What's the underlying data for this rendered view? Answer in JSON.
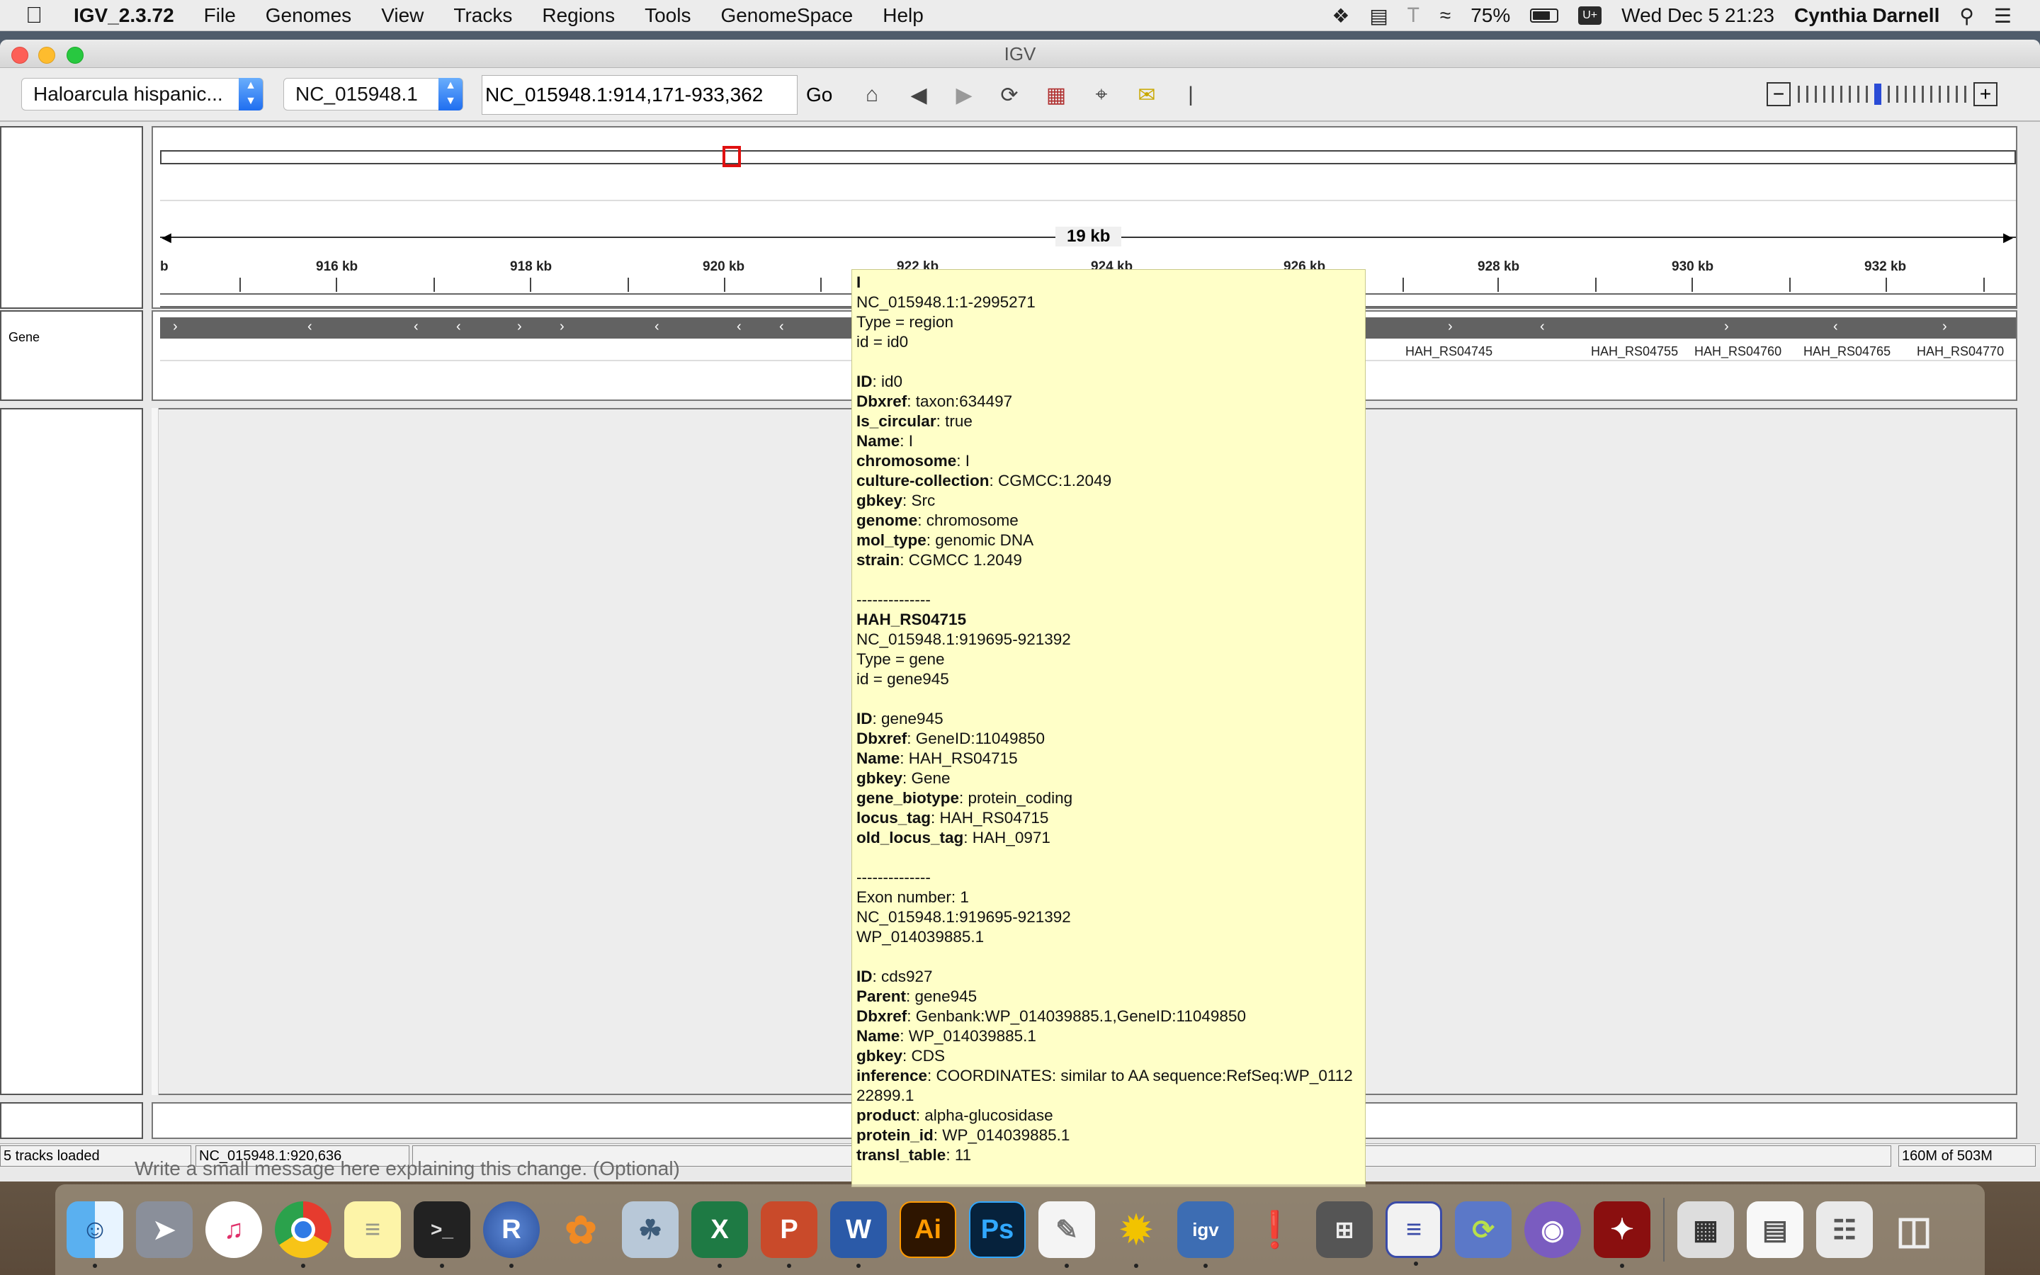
{
  "menubar": {
    "app_name": "IGV_2.3.72",
    "menus": [
      "File",
      "Genomes",
      "View",
      "Tracks",
      "Regions",
      "Tools",
      "GenomeSpace",
      "Help"
    ],
    "battery_pct": "75%",
    "battery_level": 0.75,
    "clock": "Wed Dec 5  21:23",
    "user": "Cynthia Darnell"
  },
  "window": {
    "title": "IGV"
  },
  "toolbar": {
    "genome": "Haloarcula hispanic...",
    "chromosome": "NC_015948.1",
    "locus": "NC_015948.1:914,171-933,362",
    "go_label": "Go"
  },
  "ruler": {
    "span_label": "19 kb",
    "ticks": [
      "916 kb",
      "918 kb",
      "920 kb",
      "922 kb",
      "924 kb",
      "926 kb",
      "928 kb",
      "930 kb",
      "932 kb"
    ],
    "first_partial": "b"
  },
  "tracks": {
    "gene_track_name": "Gene",
    "gene_labels": [
      "HAH_RS04745",
      "HAH_RS04755",
      "HAH_RS04760",
      "HAH_RS04765",
      "HAH_RS04770"
    ]
  },
  "status": {
    "tracks_loaded": "5 tracks loaded",
    "position": "NC_015948.1:920,636",
    "memory": "160M of 503M",
    "behind_text": "Write a small message here explaining this change. (Optional)"
  },
  "popup": {
    "lines": [
      {
        "k": "",
        "v": "I",
        "bold": true
      },
      {
        "k": "",
        "v": "NC_015948.1:1-2995271"
      },
      {
        "k": "",
        "v": "Type = region"
      },
      {
        "k": "",
        "v": "id = id0"
      },
      {
        "blank": true
      },
      {
        "k": "ID",
        "v": ": id0"
      },
      {
        "k": "Dbxref",
        "v": ": taxon:634497"
      },
      {
        "k": "Is_circular",
        "v": ": true"
      },
      {
        "k": "Name",
        "v": ": I"
      },
      {
        "k": "chromosome",
        "v": ": I"
      },
      {
        "k": "culture-collection",
        "v": ": CGMCC:1.2049"
      },
      {
        "k": "gbkey",
        "v": ": Src"
      },
      {
        "k": "genome",
        "v": ": chromosome"
      },
      {
        "k": "mol_type",
        "v": ": genomic DNA"
      },
      {
        "k": "strain",
        "v": ": CGMCC 1.2049"
      },
      {
        "blank": true
      },
      {
        "k": "",
        "v": "--------------"
      },
      {
        "k": "",
        "v": "HAH_RS04715",
        "bold": true
      },
      {
        "k": "",
        "v": "NC_015948.1:919695-921392"
      },
      {
        "k": "",
        "v": "Type = gene"
      },
      {
        "k": "",
        "v": "id = gene945"
      },
      {
        "blank": true
      },
      {
        "k": "ID",
        "v": ": gene945"
      },
      {
        "k": "Dbxref",
        "v": ": GeneID:11049850"
      },
      {
        "k": "Name",
        "v": ": HAH_RS04715"
      },
      {
        "k": "gbkey",
        "v": ": Gene"
      },
      {
        "k": "gene_biotype",
        "v": ": protein_coding"
      },
      {
        "k": "locus_tag",
        "v": ": HAH_RS04715"
      },
      {
        "k": "old_locus_tag",
        "v": ": HAH_0971"
      },
      {
        "blank": true
      },
      {
        "k": "",
        "v": "--------------"
      },
      {
        "k": "",
        "v": "Exon number: 1"
      },
      {
        "k": "",
        "v": "NC_015948.1:919695-921392"
      },
      {
        "k": "",
        "v": "WP_014039885.1"
      },
      {
        "blank": true
      },
      {
        "k": "ID",
        "v": ": cds927"
      },
      {
        "k": "Parent",
        "v": ": gene945"
      },
      {
        "k": "Dbxref",
        "v": ": Genbank:WP_014039885.1,GeneID:11049850"
      },
      {
        "k": "Name",
        "v": ": WP_014039885.1"
      },
      {
        "k": "gbkey",
        "v": ": CDS"
      },
      {
        "k": "inference",
        "v": ": COORDINATES: similar to AA sequence:RefSeq:WP_0112"
      },
      {
        "k": "",
        "v": "22899.1"
      },
      {
        "k": "product",
        "v": ": alpha-glucosidase"
      },
      {
        "k": "protein_id",
        "v": ": WP_014039885.1"
      },
      {
        "k": "transl_table",
        "v": ": 11"
      }
    ]
  },
  "dock": {
    "apps": [
      "finder-icon",
      "launchpad-icon",
      "itunes-icon",
      "chrome-icon",
      "notes-icon",
      "terminal-icon",
      "r-icon",
      "cytoscape-icon",
      "preview-icon",
      "excel-icon",
      "powerpoint-icon",
      "word-icon",
      "illustrator-icon",
      "photoshop-icon",
      "textedit-icon",
      "scribus-icon",
      "igv-icon",
      "fiji-icon",
      "calculator-icon",
      "app-icon",
      "app2-icon",
      "github-icon",
      "acrobat-icon",
      "folder-icon",
      "downloads-icon",
      "stack-icon",
      "trash-icon"
    ],
    "labels": {
      "word": "W",
      "excel": "X",
      "powerpoint": "P",
      "illustrator": "Ai",
      "photoshop": "Ps",
      "r": "R",
      "igv": "igv"
    }
  }
}
